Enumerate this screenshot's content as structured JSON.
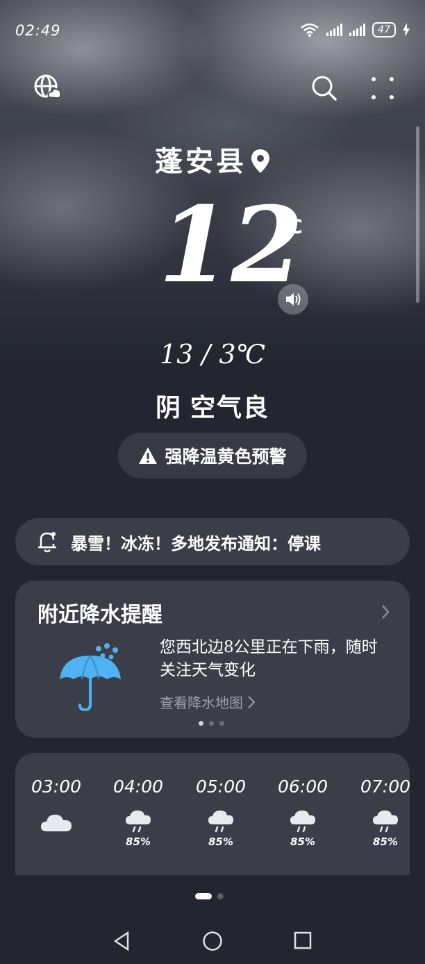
{
  "status_bar": {
    "time": "02:49",
    "battery": "47"
  },
  "location": {
    "city": "蓬安县"
  },
  "current": {
    "temperature": "12",
    "unit": "℃",
    "range": "13 / 3℃",
    "condition": "阴",
    "air_quality": "空气良"
  },
  "alert": {
    "label": "强降温黄色预警"
  },
  "notice": {
    "text": "暴雪！冰冻！多地发布通知：停课"
  },
  "precip_card": {
    "title": "附近降水提醒",
    "message": "您西北边8公里正在下雨，随时关注天气变化",
    "link": "查看降水地图",
    "dots_total": 3,
    "dots_active": 1
  },
  "hourly": [
    {
      "time": "03:00",
      "icon": "cloud-icon",
      "precip": ""
    },
    {
      "time": "04:00",
      "icon": "rain-cloud-icon",
      "precip": "85%"
    },
    {
      "time": "05:00",
      "icon": "rain-cloud-icon",
      "precip": "85%"
    },
    {
      "time": "06:00",
      "icon": "rain-cloud-icon",
      "precip": "85%"
    },
    {
      "time": "07:00",
      "icon": "rain-cloud-icon",
      "precip": "85%"
    }
  ],
  "colors": {
    "background": "#232630",
    "card": "#3b3e48",
    "umbrella": "#4fb3f0"
  },
  "icons": [
    "globe-weather-icon",
    "search-icon",
    "menu-dots-icon",
    "location-pin-icon",
    "speaker-icon",
    "warning-triangle-icon",
    "bell-icon",
    "umbrella-icon",
    "chevron-right-icon"
  ]
}
